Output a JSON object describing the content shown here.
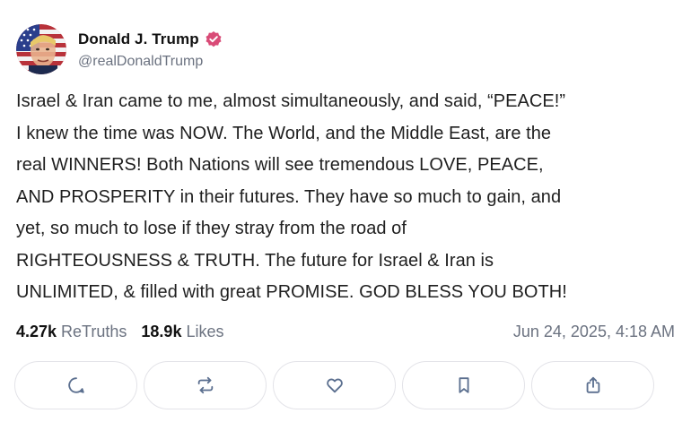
{
  "author": {
    "display_name": "Donald J. Trump",
    "handle": "@realDonaldTrump",
    "verified_color": "#d94b77"
  },
  "post": {
    "text": "Israel & Iran came to me, almost simultaneously, and said, “PEACE!”\nI knew the time was NOW. The World, and the Middle East, are the\nreal WINNERS! Both Nations will see tremendous LOVE, PEACE,\nAND PROSPERITY in their futures. They have so much to gain, and\nyet, so much to lose if they stray from the road of\nRIGHTEOUSNESS & TRUTH. The future for Israel & Iran is\nUNLIMITED, & filled with great PROMISE. GOD BLESS YOU BOTH!"
  },
  "stats": {
    "retruths_count": "4.27k",
    "retruths_label": "ReTruths",
    "likes_count": "18.9k",
    "likes_label": "Likes",
    "timestamp": "Jun 24, 2025, 4:18 AM"
  },
  "actions": [
    {
      "icon": "reply-icon"
    },
    {
      "icon": "retruth-icon"
    },
    {
      "icon": "like-icon"
    },
    {
      "icon": "bookmark-icon"
    },
    {
      "icon": "share-icon"
    }
  ],
  "colors": {
    "text": "#1f1f1f",
    "muted": "#6b7280",
    "border": "#e3e3e8",
    "icon": "#5b6f8f"
  }
}
